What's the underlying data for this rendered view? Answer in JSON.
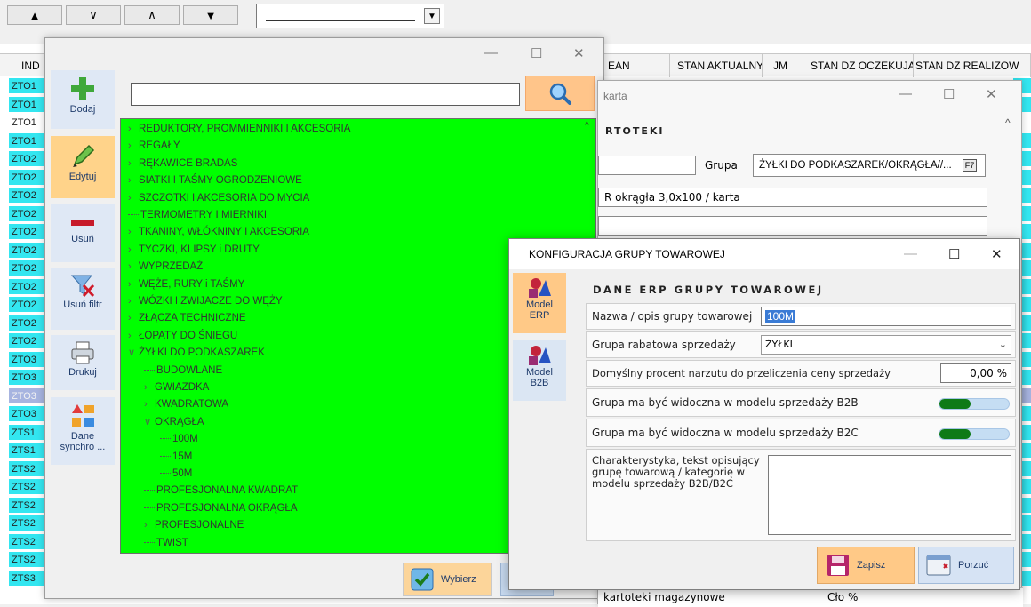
{
  "toolbar": {
    "buttons": [
      "▲",
      "∨",
      "∧",
      "▼"
    ],
    "dropdown_value": ""
  },
  "grid": {
    "columns": [
      "IND",
      "EAN",
      "STAN AKTUALNY",
      "JM",
      "STAN DZ OCZEKUJĄCE",
      "STAN DZ REALIZOW"
    ],
    "rows": [
      "ZTO1",
      "ZTO1",
      "ZTO1",
      "ZTO1",
      "ZTO2",
      "ZTO2",
      "ZTO2",
      "ZTO2",
      "ZTO2",
      "ZTO2",
      "ZTO2",
      "ZTO2",
      "ZTO2",
      "ZTO2",
      "ZTO2",
      "ZTO3",
      "ZTO3",
      "ZTO3",
      "ZTO3",
      "ZTS1",
      "ZTS1",
      "ZTS2",
      "ZTS2",
      "ZTS2",
      "ZTS2",
      "ZTS2",
      "ZTS2",
      "ZTS3"
    ]
  },
  "tree_window": {
    "controls": {
      "minimize": "—",
      "maximize": "☐",
      "close": "✕"
    },
    "sidebar": [
      {
        "label": "Dodaj",
        "icon": "plus-icon"
      },
      {
        "label": "Edytuj",
        "icon": "pencil-icon"
      },
      {
        "label": "Usuń",
        "icon": "minus-icon"
      },
      {
        "label": "Usuń filtr",
        "icon": "filter-remove-icon"
      },
      {
        "label": "Drukuj",
        "icon": "printer-icon"
      },
      {
        "label": "Dane synchro ...",
        "icon": "sync-shapes-icon"
      }
    ],
    "search_value": "",
    "tree": [
      {
        "label": "REDUKTORY, PROMMIENNIKI I AKCESORIA",
        "level": 0,
        "marker": "›"
      },
      {
        "label": "REGAŁY",
        "level": 0,
        "marker": "›"
      },
      {
        "label": "RĘKAWICE BRADAS",
        "level": 0,
        "marker": "›"
      },
      {
        "label": "SIATKI I TAŚMY OGRODZENIOWE",
        "level": 0,
        "marker": "›"
      },
      {
        "label": "SZCZOTKI I AKCESORIA DO MYCIA",
        "level": 0,
        "marker": "›"
      },
      {
        "label": "TERMOMETRY I MIERNIKI",
        "level": 0,
        "marker": "-"
      },
      {
        "label": "TKANINY, WŁÓKNINY I AKCESORIA",
        "level": 0,
        "marker": "›"
      },
      {
        "label": "TYCZKI, KLIPSY i DRUTY",
        "level": 0,
        "marker": "›"
      },
      {
        "label": "WYPRZEDAŻ",
        "level": 0,
        "marker": "›"
      },
      {
        "label": "WĘŻE, RURY i TAŚMY",
        "level": 0,
        "marker": "›"
      },
      {
        "label": "WÓZKI I ZWIJACZE DO WĘŻY",
        "level": 0,
        "marker": "›"
      },
      {
        "label": "ZŁĄCZA TECHNICZNE",
        "level": 0,
        "marker": "›"
      },
      {
        "label": "ŁOPATY DO ŚNIEGU",
        "level": 0,
        "marker": "›"
      },
      {
        "label": "ŻYŁKI DO PODKASZAREK",
        "level": 0,
        "marker": "∨"
      },
      {
        "label": "BUDOWLANE",
        "level": 1,
        "marker": "-"
      },
      {
        "label": "GWIAZDKA",
        "level": 1,
        "marker": "›"
      },
      {
        "label": "KWADRATOWA",
        "level": 1,
        "marker": "›"
      },
      {
        "label": "OKRĄGŁA",
        "level": 1,
        "marker": "∨"
      },
      {
        "label": "100M",
        "level": 2,
        "marker": "-"
      },
      {
        "label": "15M",
        "level": 2,
        "marker": "-"
      },
      {
        "label": "50M",
        "level": 2,
        "marker": "-"
      },
      {
        "label": "PROFESJONALNA KWADRAT",
        "level": 1,
        "marker": "-"
      },
      {
        "label": "PROFESJONALNA OKRĄGŁA",
        "level": 1,
        "marker": "-"
      },
      {
        "label": "PROFESJONALNE",
        "level": 1,
        "marker": "›"
      },
      {
        "label": "TWIST",
        "level": 1,
        "marker": "-"
      }
    ],
    "select_button": "Wybierz"
  },
  "karta_window": {
    "title": "karta",
    "section": "RTOTEKI",
    "grupa_label": "Grupa",
    "grupa_value": "ŻYŁKI DO PODKASZAREK/OKRĄGŁA//...",
    "f7": "F7",
    "name_value": "R okrągła 3,0x100 / karta",
    "bottom_left": "kartoteki magazynowe",
    "bottom_right": "Cło %"
  },
  "konf_window": {
    "title": "KONFIGURACJA GRUPY TOWAROWEJ",
    "side": [
      {
        "label": "Model ERP"
      },
      {
        "label": "Model B2B"
      }
    ],
    "heading": "DANE ERP GRUPY TOWAROWEJ",
    "name_label": "Nazwa / opis grupy towarowej",
    "name_value": "100M",
    "rabat_label": "Grupa rabatowa sprzedaży",
    "rabat_value": "ŻYŁKI",
    "narzut_label": "Domyślny procent narzutu do przeliczenia ceny sprzedaży",
    "narzut_value": "0,00 %",
    "b2b_label": "Grupa ma być widoczna w modelu sprzedaży B2B",
    "b2b_level": 0.45,
    "b2c_label": "Grupa ma być widoczna w modelu sprzedaży B2C",
    "b2c_level": 0.45,
    "char_label": "Charakterystyka, tekst opisujący grupę towarową / kategorię w modelu sprzedaży B2B/B2C",
    "char_value": "",
    "save": "Zapisz",
    "cancel": "Porzuć"
  }
}
